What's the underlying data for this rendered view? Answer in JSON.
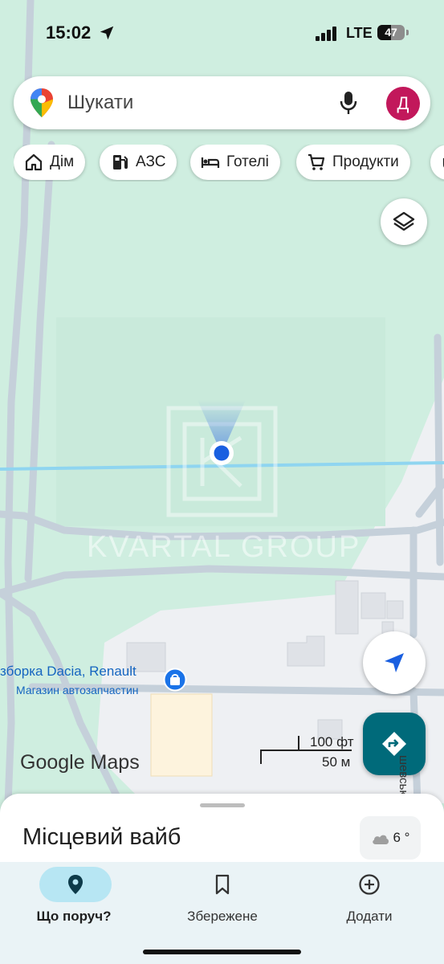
{
  "status_bar": {
    "time": "15:02",
    "network": "LTE",
    "battery": "47"
  },
  "search": {
    "placeholder": "Шукати",
    "avatar_letter": "Д"
  },
  "chips": [
    {
      "label": "Дім",
      "icon": "home-icon"
    },
    {
      "label": "АЗС",
      "icon": "gas-station-icon"
    },
    {
      "label": "Готелі",
      "icon": "bed-icon"
    },
    {
      "label": "Продукти",
      "icon": "cart-icon"
    }
  ],
  "map": {
    "watermark": "KVARTAL GROUP",
    "poi": {
      "title": "зборка Dacia, Renault",
      "subtitle": "Магазин автозапчастин"
    },
    "scale": {
      "imperial": "100 фт",
      "metric": "50 м"
    },
    "street": "шевського",
    "logo": "Google Maps",
    "colors": {
      "park": "#cfeee0",
      "road": "#c5d0da",
      "urban": "#eef0f3",
      "water": "#8fd5f0",
      "accent": "#006a7a"
    }
  },
  "sheet": {
    "title": "Місцевий вайб",
    "temperature": "6 °"
  },
  "nav": [
    {
      "label": "Що поруч?",
      "icon": "location-pin-icon",
      "active": true
    },
    {
      "label": "Збережене",
      "icon": "bookmark-icon",
      "active": false
    },
    {
      "label": "Додати",
      "icon": "add-circle-icon",
      "active": false
    }
  ]
}
